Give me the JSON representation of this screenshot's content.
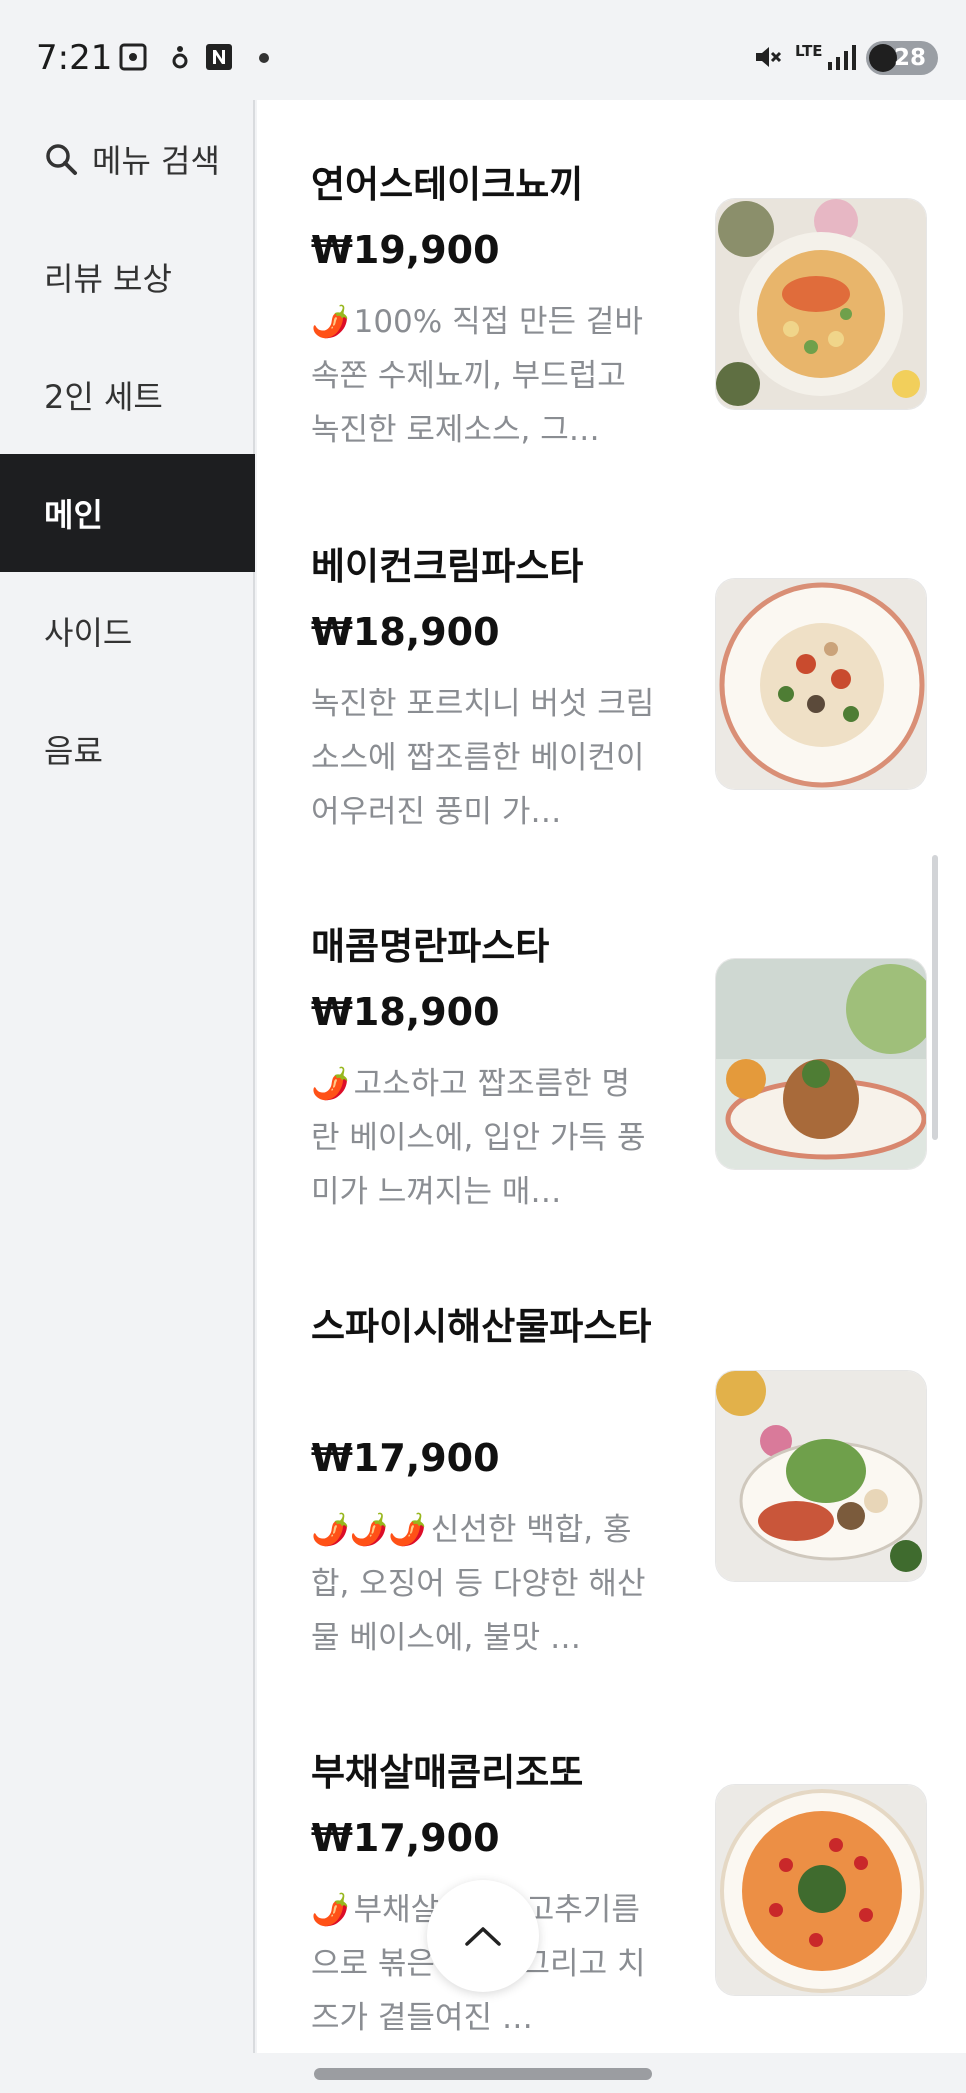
{
  "status_bar": {
    "time": "7:21",
    "network": "LTE",
    "battery": "28",
    "icons": [
      "screenshot-icon",
      "notification-icon",
      "naver-icon",
      "mute-icon",
      "signal-icon"
    ]
  },
  "sidebar": {
    "search_label": "메뉴 검색",
    "items": [
      {
        "label": "리뷰 보상"
      },
      {
        "label": "2인 세트"
      },
      {
        "label": "메인",
        "active": true
      },
      {
        "label": "사이드"
      },
      {
        "label": "음료"
      }
    ]
  },
  "menu": [
    {
      "name": "연어스테이크뇨끼",
      "price": "₩19,900",
      "chili": "🌶️",
      "desc": "100% 직접 만든 겉바속쫀 수제뇨끼, 부드럽고 녹진한 로제소스, 그…"
    },
    {
      "name": "베이컨크림파스타",
      "price": "₩18,900",
      "chili": "",
      "desc": "녹진한 포르치니 버섯 크림 소스에 짭조름한 베이컨이 어우러진 풍미 가…"
    },
    {
      "name": "매콤명란파스타",
      "price": "₩18,900",
      "chili": "🌶️",
      "desc": "고소하고 짭조름한 명란 베이스에, 입안 가득 풍미가 느껴지는 매…"
    },
    {
      "name": "스파이시해산물파스타",
      "price": "₩17,900",
      "chili": "🌶️🌶️🌶️",
      "desc": "신선한 백합, 홍합, 오징어 등 다양한 해산물 베이스에, 불맛 …"
    },
    {
      "name": "부채살매콤리조또",
      "price": "₩17,900",
      "chili": "🌶️",
      "desc": "부채살 고기, 고추기름으로 볶은 야채, 그리고 치즈가 곁들여진 …"
    }
  ],
  "colors": {
    "active_bg": "#1d1e20",
    "desc_text": "#8a8d92",
    "sidebar_bg": "#f2f3f5"
  }
}
